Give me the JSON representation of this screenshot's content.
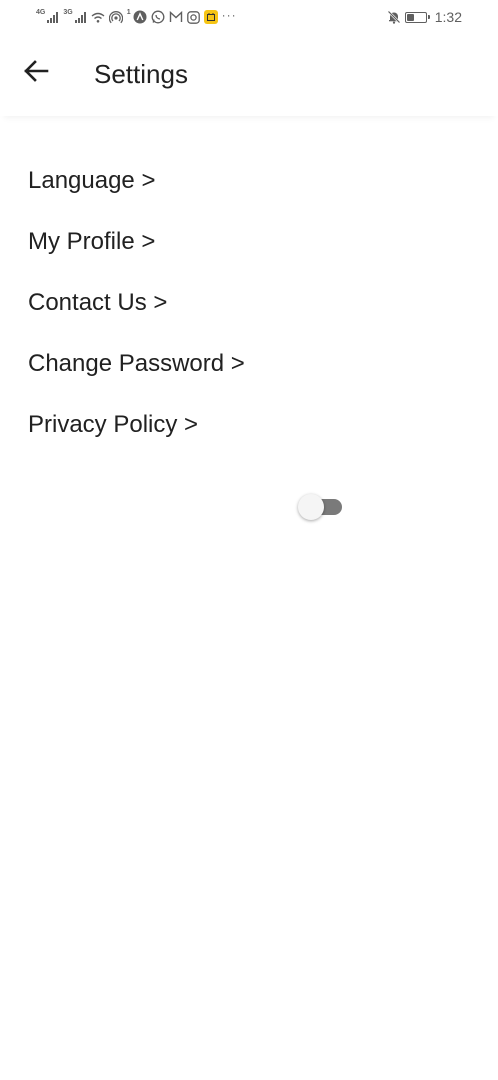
{
  "status_bar": {
    "network_1": "4G",
    "network_2": "3G",
    "notif_badge": "1",
    "more": "···",
    "time": "1:32",
    "battery_level": 0.45,
    "icons": [
      "signal-icon",
      "signal-icon",
      "wifi-icon",
      "hotspot-icon",
      "app-icon",
      "whatsapp-icon",
      "gmail-icon",
      "instagram-icon",
      "app-yellow-icon",
      "mute-icon",
      "battery-icon"
    ]
  },
  "app_bar": {
    "title": "Settings",
    "back_icon": "arrow-left-icon"
  },
  "settings": {
    "items": [
      {
        "label": "Language >"
      },
      {
        "label": "My Profile >"
      },
      {
        "label": "Contact Us >"
      },
      {
        "label": "Change Password >"
      },
      {
        "label": "Privacy Policy >"
      }
    ]
  },
  "toggle": {
    "state": "off"
  },
  "colors": {
    "text": "#212121",
    "status_icons": "#5f5f5f",
    "toggle_track": "#7a7a7a",
    "toggle_thumb": "#f5f5f5",
    "app_icon_yellow": "#f6c515"
  }
}
